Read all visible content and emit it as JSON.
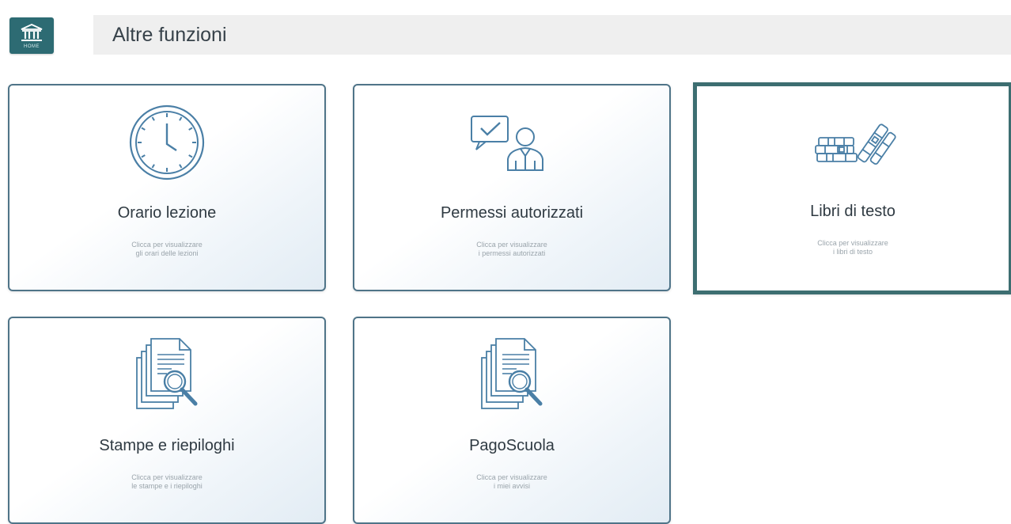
{
  "header": {
    "home_label": "HOME",
    "title": "Altre funzioni"
  },
  "cards": [
    {
      "title": "Orario lezione",
      "sub1": "Clicca per visualizzare",
      "sub2": "gli orari delle lezioni",
      "icon": "clock-icon"
    },
    {
      "title": "Permessi autorizzati",
      "sub1": "Clicca per visualizzare",
      "sub2": "i permessi autorizzati",
      "icon": "approved-permission-icon"
    },
    {
      "title": "Libri di testo",
      "sub1": "Clicca per visualizzare",
      "sub2": "i libri di testo",
      "icon": "books-icon"
    },
    {
      "title": "Stampe e riepiloghi",
      "sub1": "Clicca per visualizzare",
      "sub2": "le stampe e i riepiloghi",
      "icon": "documents-search-icon"
    },
    {
      "title": "PagoScuola",
      "sub1": "Clicca per visualizzare",
      "sub2": "i miei avvisi",
      "icon": "documents-search-icon"
    }
  ],
  "colors": {
    "accent": "#2d6b73",
    "card_border": "#4f7488",
    "icon_stroke": "#4a7fa6",
    "selected_border": "#3d6e71"
  }
}
